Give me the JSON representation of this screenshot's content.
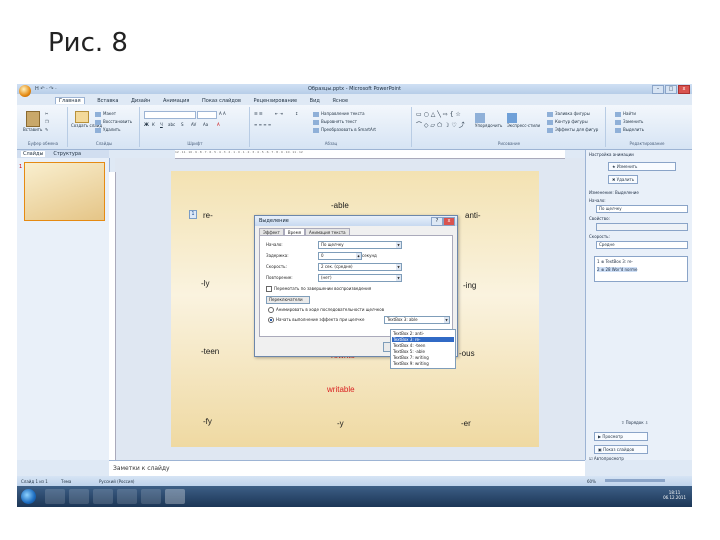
{
  "slide_title": "Рис. 8",
  "window": {
    "title": "Образцы.pptx - Microsoft PowerPoint",
    "qat": "H ↶ · ↷ ·",
    "buttons": [
      "–",
      "□",
      "x"
    ]
  },
  "ribbon": {
    "tabs": [
      "Главная",
      "Вставка",
      "Дизайн",
      "Анимация",
      "Показ слайдов",
      "Рецензирование",
      "Вид",
      "Ясное"
    ],
    "active_tab": "Главная",
    "groups": [
      "Буфер обмена",
      "Слайды",
      "Шрифт",
      "Абзац",
      "Рисование",
      "Редактирование"
    ],
    "paste_label": "Вставить",
    "new_slide_label": "Создать слайд",
    "layout_label": "Макет",
    "reset_label": "Восстановить",
    "delete_label": "Удалить",
    "arrange_label": "Упорядочить",
    "quick_styles_label": "Экспресс-стили",
    "fill_label": "Заливка фигуры",
    "outline_label": "Контур фигуры",
    "effects_label": "Эффекты для фигур",
    "find_label": "Найти",
    "replace_label": "Заменить",
    "select_label": "Выделить",
    "text_direction_label": "Направление текста",
    "align_text_label": "Выровнять текст",
    "smartart_label": "Преобразовать в SmartArt"
  },
  "left_pane": {
    "tabs": [
      "Слайды",
      "Структура"
    ],
    "active_tab": "Слайды",
    "slide_number": "1"
  },
  "ruler_text": "12 · 11 · 10 · 9 · 8 · 7 · 6 · 5 · 4 · 3 · 2 · 1 · 0 · 1 · 2 · 3 · 4 · 5 · 6 · 7 · 8 · 9 · 10 · 11 · 12",
  "slide": {
    "marker": "1",
    "words": {
      "able": "-able",
      "re": "re-",
      "anti": "anti-",
      "ly": "-ly",
      "ing": "-ing",
      "teen": "-teen",
      "ous": "-ous",
      "writable": "writable",
      "hidden_red": "rewrite",
      "fy": "-fy",
      "y": "-y",
      "er": "-er"
    }
  },
  "dialog": {
    "title": "Выделение",
    "close": "x",
    "help": "?",
    "tabs": [
      "Эффект",
      "Время",
      "Анимация текста"
    ],
    "active_tab": "Время",
    "start_label": "Начало:",
    "start_value": "По щелчку",
    "delay_label": "Задержка:",
    "delay_value": "0",
    "delay_unit": "секунд",
    "duration_label": "Скорость:",
    "duration_value": "2 сек. (средне)",
    "repeat_label": "Повторение:",
    "repeat_value": "(нет)",
    "rewind_label": "Перемотать по завершении воспроизведения",
    "triggers_label": "Переключатели",
    "radio1_label": "Анимировать в ходе последовательности щелчков",
    "radio2_label": "Начать выполнение эффекта при щелчке",
    "trigger_value": "TextBox 3: able",
    "ok_label": "ОК",
    "cancel_label": "Отмена"
  },
  "dropdown_items": [
    "TextBox 2: anti-",
    "TextBox 3: re-",
    "TextBox 4: -teen",
    "TextBox 5: -able",
    "TextBox 7: writing",
    "TextBox 9: writing"
  ],
  "dropdown_selected": 1,
  "task_pane": {
    "title": "Настройка анимации",
    "change_label": "Изменить",
    "delete_label": "Удалить",
    "modify_label": "Изменение: Выделение",
    "start_label": "Начало:",
    "start_value": "По щелчку",
    "property_label": "Свойство:",
    "speed_label": "Скорость:",
    "speed_value": "Средне",
    "list_items": [
      "1 ⊗ TextBox 3: re-",
      "2 ⊗ 28 Wor'd norme"
    ],
    "reorder_label": "Порядок",
    "play_label": "Просмотр",
    "slideshow_label": "Показ слайдов",
    "autopreview_label": "Автопросмотр"
  },
  "notes_text": "Заметки к слайду",
  "status": {
    "slide_info": "Слайд 1 из 1",
    "theme": "Тема",
    "language": "Русский (Россия)",
    "zoom": "60%"
  },
  "taskbar": {
    "time": "18:11",
    "date": "06.12.2011"
  }
}
